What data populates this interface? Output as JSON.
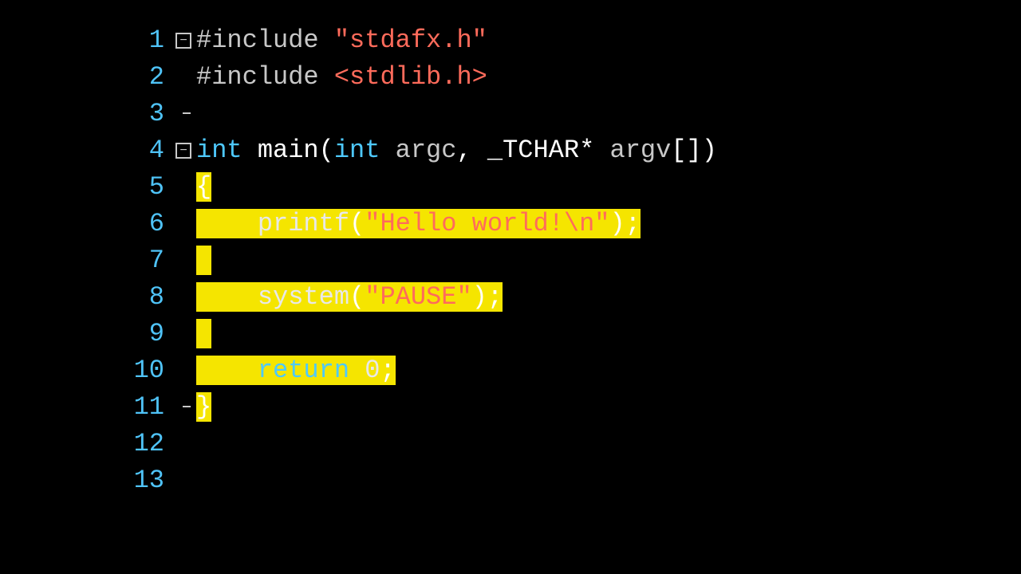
{
  "editor": {
    "line_numbers": [
      "1",
      "2",
      "3",
      "4",
      "5",
      "6",
      "7",
      "8",
      "9",
      "10",
      "11",
      "12",
      "13"
    ],
    "fold_minus": "−",
    "lines": {
      "l1": {
        "include_kw": "#include",
        "space": " ",
        "q1": "\"",
        "header": "stdafx.h",
        "q2": "\""
      },
      "l2": {
        "include_kw": "#include",
        "space": " ",
        "open": "<",
        "header": "stdlib.h",
        "close": ">"
      },
      "l4": {
        "kw_int": "int",
        "sp1": " ",
        "main": "main",
        "open": "(",
        "kw_int2": "int",
        "sp2": " ",
        "argc": "argc",
        "comma": ", ",
        "tchar": "_TCHAR",
        "star": "* ",
        "argv": "argv",
        "brackets": "[]",
        "close": ")"
      },
      "l5": {
        "brace": "{"
      },
      "l6": {
        "indent": "    ",
        "printf": "printf",
        "open": "(",
        "q1": "\"",
        "str": "Hello world!\\n",
        "q2": "\"",
        "close": ")",
        "semi": ";"
      },
      "l8": {
        "indent": "    ",
        "system": "system",
        "open": "(",
        "q1": "\"",
        "str": "PAUSE",
        "q2": "\"",
        "close": ")",
        "semi": ";"
      },
      "l10": {
        "indent": "    ",
        "kw_return": "return",
        "sp": " ",
        "zero": "0",
        "semi": ";"
      },
      "l11": {
        "brace": "}"
      }
    }
  }
}
